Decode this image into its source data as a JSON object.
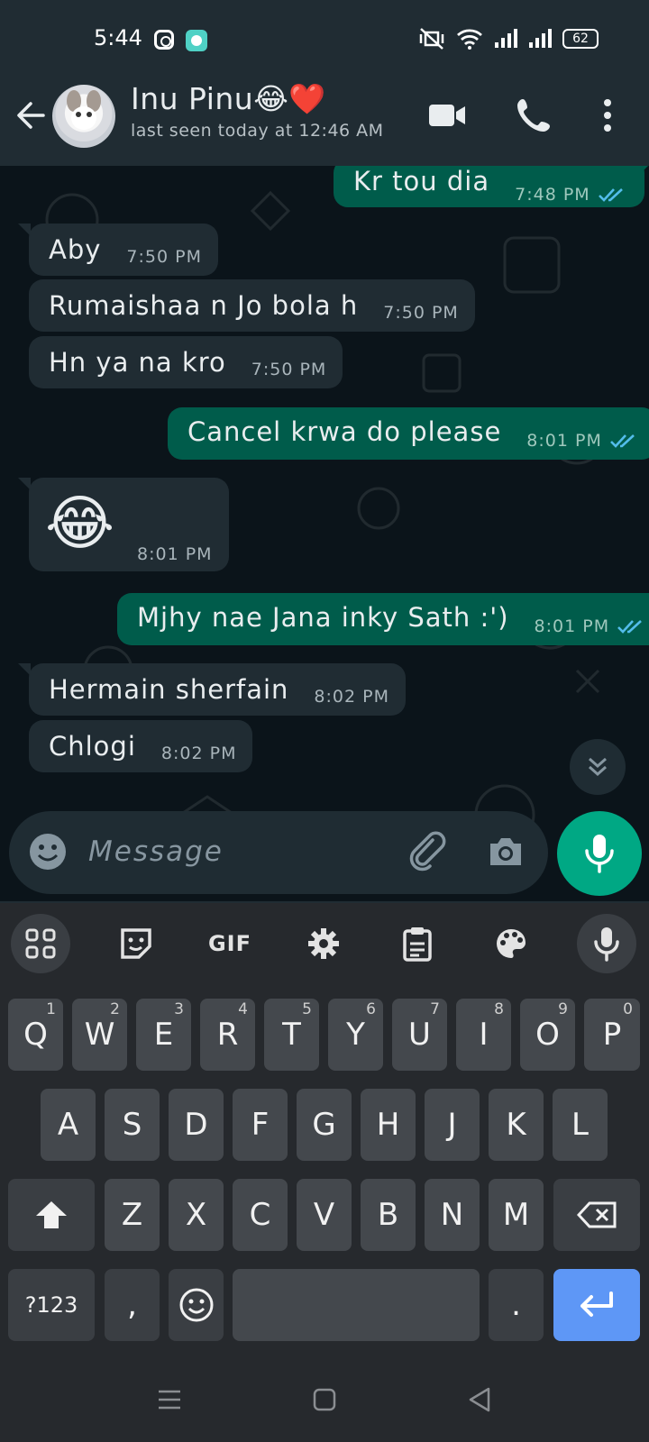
{
  "status_bar": {
    "time": "5:44",
    "battery": "62"
  },
  "header": {
    "name": "Inu Pinu",
    "name_emoji": "😂❤️",
    "last_seen": "last seen today at 12:46 AM"
  },
  "messages": [
    {
      "dir": "out",
      "text": "Kr tou dia",
      "time": "7:48 PM"
    },
    {
      "dir": "in",
      "text": "Aby",
      "time": "7:50 PM"
    },
    {
      "dir": "in",
      "text": "Rumaishaa n Jo bola h",
      "time": "7:50 PM"
    },
    {
      "dir": "in",
      "text": "Hn ya na kro",
      "time": "7:50 PM"
    },
    {
      "dir": "out",
      "text": "Cancel krwa do please",
      "time": "8:01 PM"
    },
    {
      "dir": "in",
      "text": "😂",
      "time": "8:01 PM"
    },
    {
      "dir": "out",
      "text": "Mjhy nae Jana inky Sath :')",
      "time": "8:01 PM"
    },
    {
      "dir": "in",
      "text": "Hermain sherfain",
      "time": "8:02 PM"
    },
    {
      "dir": "in",
      "text": "Chlogi",
      "time": "8:02 PM"
    }
  ],
  "composer": {
    "placeholder": "Message"
  },
  "keyboard": {
    "toolbar_gif": "GIF",
    "row1": [
      "Q",
      "W",
      "E",
      "R",
      "T",
      "Y",
      "U",
      "I",
      "O",
      "P"
    ],
    "row1_hints": [
      "1",
      "2",
      "3",
      "4",
      "5",
      "6",
      "7",
      "8",
      "9",
      "0"
    ],
    "row2": [
      "A",
      "S",
      "D",
      "F",
      "G",
      "H",
      "J",
      "K",
      "L"
    ],
    "row3": [
      "Z",
      "X",
      "C",
      "V",
      "B",
      "N",
      "M"
    ],
    "symbols_key": "?123",
    "comma_key": ",",
    "period_key": "."
  },
  "colors": {
    "header_bg": "#202c33",
    "chat_bg": "#0b141a",
    "incoming_bubble": "#202c33",
    "outgoing_bubble": "#005c4b",
    "accent_green": "#00a884",
    "read_ticks": "#53bdeb",
    "enter_key": "#5e97f6"
  }
}
